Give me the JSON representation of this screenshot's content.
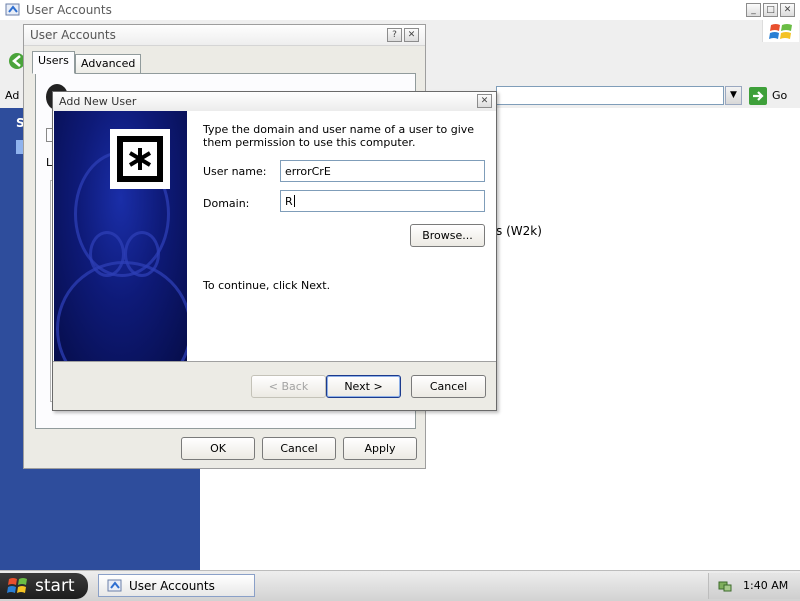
{
  "background_window": {
    "title": "User Accounts",
    "address_label": "Ad",
    "go_label": "Go",
    "left_text": "S",
    "right_fragment": "s (W2k)"
  },
  "user_accounts_dialog": {
    "title": "User Accounts",
    "tabs": [
      {
        "label": "Users",
        "selected": true
      },
      {
        "label": "Advanced",
        "selected": false
      }
    ],
    "hidden_letter": "L",
    "buttons": {
      "ok": "OK",
      "cancel": "Cancel",
      "apply": "Apply"
    }
  },
  "add_new_user": {
    "title": "Add New User",
    "instruction": "Type the domain and user name of a user to give them permission to use this computer.",
    "username_label": "User name:",
    "username_value": "errorCrE",
    "domain_label": "Domain:",
    "domain_value": "R",
    "browse_label": "Browse...",
    "continue_text": "To continue, click Next.",
    "back_label": "< Back",
    "next_label": "Next >",
    "cancel_label": "Cancel"
  },
  "taskbar": {
    "start_label": "start",
    "task_label": "User Accounts",
    "clock": "1:40 AM"
  },
  "colors": {
    "desktop_blue": "#2e4d9c",
    "banner_blue": "#0e1a78",
    "dialog_face": "#ecebe5",
    "taskbar": "#d9d9d9"
  }
}
